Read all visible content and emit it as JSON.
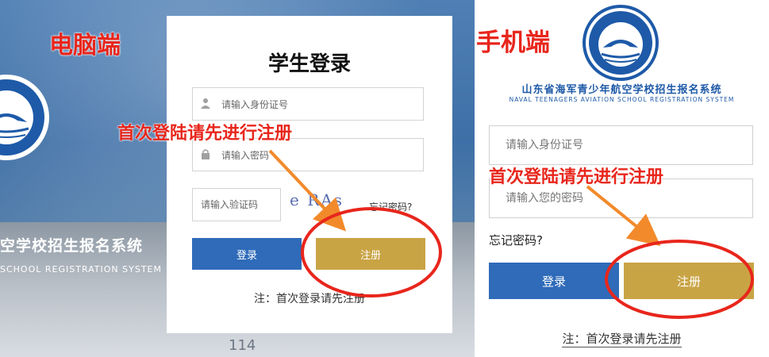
{
  "labels": {
    "pc": "电脑端",
    "mobile": "手机端",
    "first_login_hint_pc": "首次登陆请先进行注册",
    "first_login_hint_mobile": "首次登陆请先进行注册"
  },
  "pc": {
    "school_name": "空学校招生报名系统",
    "school_name_en": "SCHOOL REGISTRATION SYSTEM",
    "title": "学生登录",
    "id_placeholder": "请输入身份证号",
    "password_placeholder": "请输入密码",
    "captcha_placeholder": "请输入验证码",
    "captcha_text": "e  RAs",
    "forgot": "忘记密码?",
    "login": "登录",
    "register": "注册",
    "note": "注：首次登录请先注册",
    "deck_number": "114"
  },
  "mobile": {
    "school_name": "山东省海军青少年航空学校招生报名系统",
    "school_name_en": "NAVAL TEENAGERS AVIATION SCHOOL REGISTRATION SYSTEM",
    "id_placeholder": "请输入身份证号",
    "password_placeholder": "请输入您的密码",
    "forgot": "忘记密码?",
    "login": "登录",
    "register": "注册",
    "note": "注：首次登录请先注册"
  },
  "colors": {
    "brand_blue": "#2f6bb9",
    "register_gold": "#c9a445",
    "annotation_red": "#e8261c"
  }
}
